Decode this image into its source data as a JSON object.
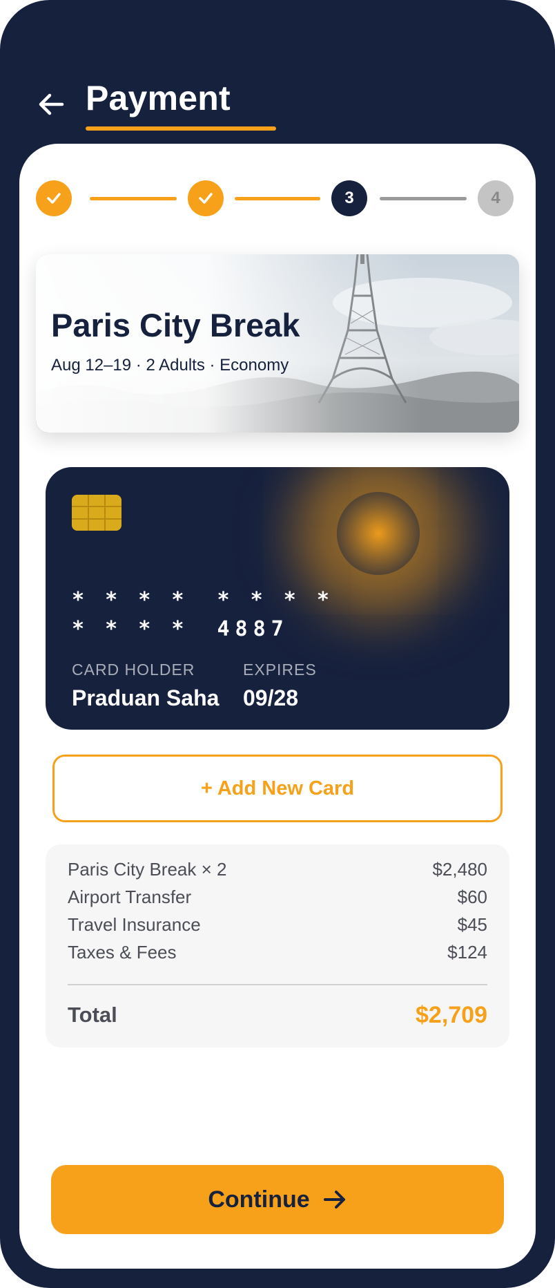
{
  "header": {
    "title": "Payment",
    "back_icon": "arrow-left-icon"
  },
  "stepper": {
    "steps": [
      {
        "state": "done",
        "label": ""
      },
      {
        "state": "done",
        "label": ""
      },
      {
        "state": "current",
        "label": "3"
      },
      {
        "state": "todo",
        "label": "4"
      }
    ]
  },
  "trip": {
    "title": "Paris City Break",
    "subtitle": "Aug 12–19 · 2 Adults · Economy"
  },
  "card": {
    "masked_groups": [
      "* * * *",
      "* * * *",
      "* * * *"
    ],
    "last_four": "4887",
    "holder_label": "CARD HOLDER",
    "holder_name": "Praduan Saha",
    "expires_label": "EXPIRES",
    "expires_value": "09/28"
  },
  "add_card": {
    "label": "+ Add New Card"
  },
  "summary": {
    "items": [
      {
        "label": "Paris City Break × 2",
        "amount": "$2,480"
      },
      {
        "label": "Airport Transfer",
        "amount": "$60"
      },
      {
        "label": "Travel Insurance",
        "amount": "$45"
      },
      {
        "label": "Taxes & Fees",
        "amount": "$124"
      }
    ],
    "total_label": "Total",
    "total_value": "$2,709"
  },
  "continue": {
    "label": "Continue",
    "icon": "arrow-right-icon"
  },
  "colors": {
    "navy": "#16213e",
    "accent": "#f7a11a",
    "muted": "#c4c4c4"
  }
}
